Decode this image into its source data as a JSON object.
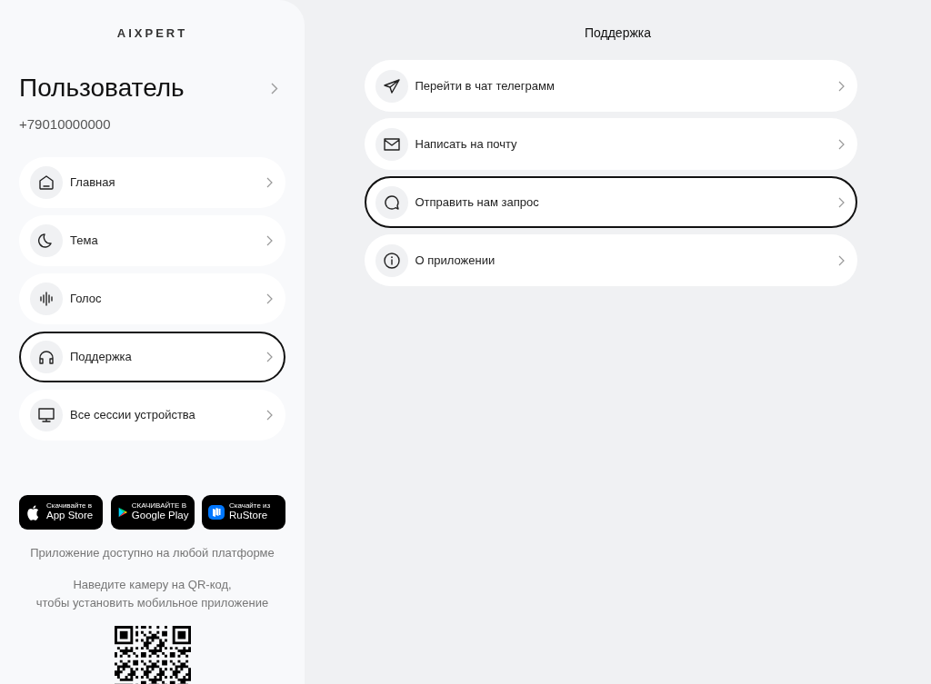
{
  "logo": "AIXPERT",
  "user": {
    "name": "Пользователь",
    "phone": "+79010000000"
  },
  "sidebar": {
    "items": [
      {
        "label": "Главная",
        "selected": false
      },
      {
        "label": "Тема",
        "selected": false
      },
      {
        "label": "Голос",
        "selected": false
      },
      {
        "label": "Поддержка",
        "selected": true
      },
      {
        "label": "Все сессии устройства",
        "selected": false
      }
    ]
  },
  "stores": [
    {
      "kind": "apple",
      "caption": "Скачивайте в",
      "name": "App Store"
    },
    {
      "kind": "google",
      "caption": "СКАЧИВАЙТЕ В",
      "name": "Google Play"
    },
    {
      "kind": "rustore",
      "caption": "Скачайте из",
      "name": "RuStore"
    }
  ],
  "platform_note": "Приложение доступно на любой платформе",
  "qr_note": "Наведите камеру на QR-код,\nчтобы установить мобильное приложение",
  "page_title": "Поддержка",
  "support_items": [
    {
      "label": "Перейти в чат телеграмм",
      "focused": false
    },
    {
      "label": "Написать на почту",
      "focused": false
    },
    {
      "label": "Отправить нам запрос",
      "focused": true
    },
    {
      "label": "О приложении",
      "focused": false
    }
  ]
}
